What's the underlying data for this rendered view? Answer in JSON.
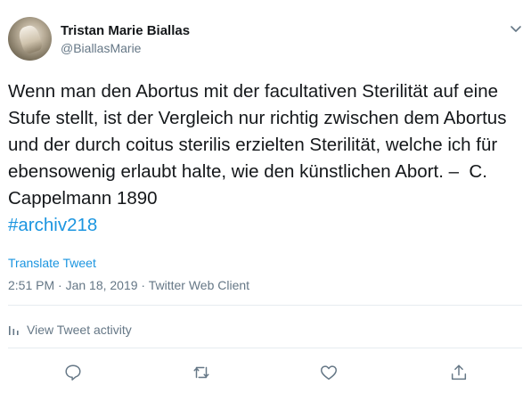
{
  "author": {
    "name": "Tristan Marie Biallas",
    "handle": "@BiallasMarie",
    "avatar_icon": "avatar-photo"
  },
  "tweet": {
    "text": "Wenn man den Abortus mit der facultativen Sterilität auf eine Stufe stellt, ist der Vergleich nur richtig zwischen dem Abortus und der durch coitus sterilis erzielten Sterilität, welche ich für ebensowenig erlaubt halte, wie den künstlichen Abort. –  C. Cappelmann 1890",
    "hashtag": "#archiv218",
    "translate_label": "Translate Tweet",
    "timestamp": "2:51 PM · Jan 18, 2019 · Twitter Web Client"
  },
  "activity": {
    "label": "View Tweet activity",
    "icon": "bar-chart-icon"
  },
  "actions": [
    {
      "name": "reply",
      "icon": "reply-icon"
    },
    {
      "name": "retweet",
      "icon": "retweet-icon"
    },
    {
      "name": "like",
      "icon": "heart-icon"
    },
    {
      "name": "share",
      "icon": "share-icon"
    }
  ],
  "colors": {
    "text": "#14171a",
    "secondary": "#657786",
    "link": "#1b95e0",
    "divider": "#e6ecf0"
  }
}
